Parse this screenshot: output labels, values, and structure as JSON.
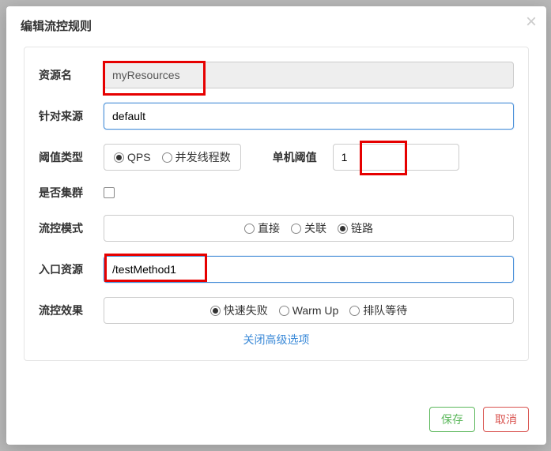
{
  "modal": {
    "title": "编辑流控规则",
    "close_advanced": "关闭高级选项",
    "save_label": "保存",
    "cancel_label": "取消"
  },
  "labels": {
    "resource": "资源名",
    "origin": "针对来源",
    "threshold_type": "阈值类型",
    "single_threshold": "单机阈值",
    "cluster": "是否集群",
    "mode": "流控模式",
    "entry": "入口资源",
    "effect": "流控效果"
  },
  "values": {
    "resource": "myResources",
    "origin": "default",
    "single_threshold": "1",
    "entry": "/testMethod1"
  },
  "threshold_type": {
    "options": [
      {
        "label": "QPS",
        "checked": true
      },
      {
        "label": "并发线程数",
        "checked": false
      }
    ]
  },
  "mode": {
    "options": [
      {
        "label": "直接",
        "checked": false
      },
      {
        "label": "关联",
        "checked": false
      },
      {
        "label": "链路",
        "checked": true
      }
    ]
  },
  "effect": {
    "options": [
      {
        "label": "快速失败",
        "checked": true
      },
      {
        "label": "Warm Up",
        "checked": false
      },
      {
        "label": "排队等待",
        "checked": false
      }
    ]
  }
}
